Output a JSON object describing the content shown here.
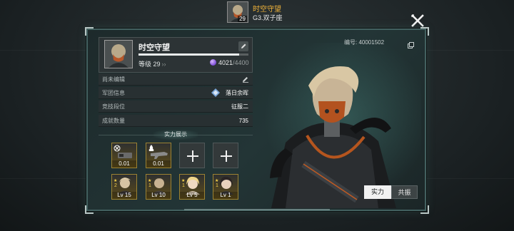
{
  "header": {
    "player_name": "时空守望",
    "avatar_level": "29",
    "server_tag": "G3.双子座"
  },
  "profile": {
    "name": "时空守望",
    "level_label": "等级 29",
    "exp_current": "4021",
    "exp_max": "/4400",
    "exp_progress": 0.914,
    "serial_label": "编号: 40001502"
  },
  "info": {
    "signature": "尚未编辑",
    "legion_label": "军团信息",
    "legion_value": "落日余晖",
    "rank_label": "竞技段位",
    "rank_value": "征服二",
    "achievement_label": "成就数量",
    "achievement_value": "735"
  },
  "showcase": {
    "title": "实力展示",
    "equipment": [
      {
        "icon": "weapon-chip-icon",
        "value": "0.01"
      },
      {
        "icon": "gun-module-icon",
        "value": "0.01"
      },
      {
        "icon": "plus-icon",
        "value": ""
      },
      {
        "icon": "plus-icon",
        "value": ""
      }
    ],
    "characters": [
      {
        "stars": "2",
        "level": "Lv 15"
      },
      {
        "stars": "1",
        "level": "Lv 10"
      },
      {
        "stars": "1",
        "level": "Lv 5"
      },
      {
        "stars": "1",
        "level": "Lv 1"
      }
    ]
  },
  "tabs": {
    "strength": "实力",
    "bond": "共振"
  },
  "colors": {
    "accent_gold": "#f2b43a",
    "panel_border": "#42605f",
    "exp_crystal": "#7b4bd6"
  }
}
